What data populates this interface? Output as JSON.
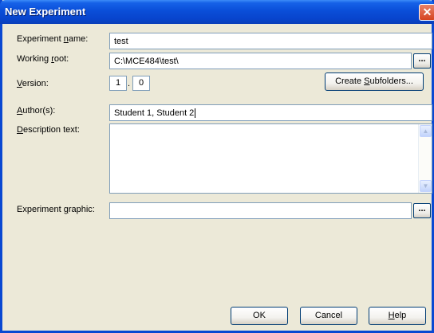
{
  "window": {
    "title": "New Experiment"
  },
  "labels": {
    "experiment_name": [
      "Experiment ",
      "n",
      "ame:"
    ],
    "working_root": [
      "Working ",
      "r",
      "oot:"
    ],
    "version": [
      "",
      "V",
      "ersion:"
    ],
    "author": [
      "",
      "A",
      "uthor(s):"
    ],
    "description": [
      "",
      "D",
      "escription text:"
    ],
    "graphic": [
      "Experiment ",
      "g",
      "raphic:"
    ]
  },
  "fields": {
    "experiment_name": "test",
    "working_root": "C:\\MCE484\\test\\",
    "version_major": "1",
    "version_minor": "0",
    "author": "Student 1, Student 2",
    "description": "",
    "graphic": ""
  },
  "buttons": {
    "browse": "...",
    "create_subfolders": [
      "Create ",
      "S",
      "ubfolders..."
    ],
    "ok": "OK",
    "cancel": "Cancel",
    "help": [
      "",
      "H",
      "elp"
    ]
  },
  "separator": "."
}
